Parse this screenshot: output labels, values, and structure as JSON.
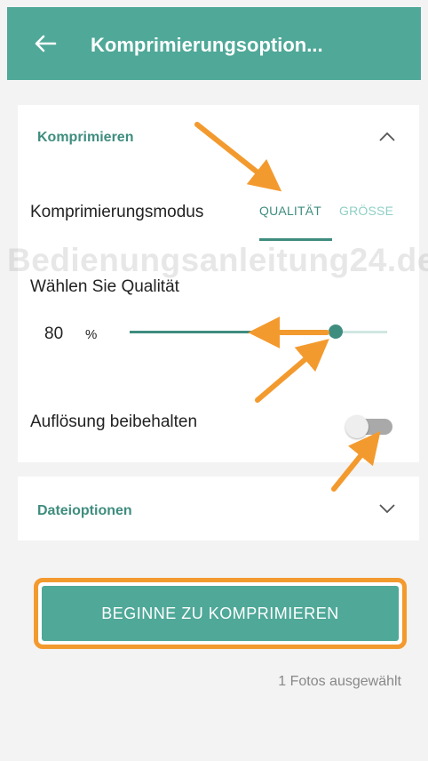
{
  "appbar": {
    "title": "Komprimierungsoption..."
  },
  "compress_section": {
    "title": "Komprimieren",
    "mode_label": "Komprimierungsmodus",
    "tabs": [
      {
        "label": "QUALITÄT",
        "selected": true
      },
      {
        "label": "GRÖSSE",
        "selected": false
      }
    ],
    "quality_label": "Wählen Sie Qualität",
    "quality_value": "80",
    "quality_unit": "%",
    "quality_slider_fraction": 0.8,
    "keep_resolution_label": "Auflösung beibehalten",
    "keep_resolution_on": false
  },
  "file_section": {
    "title": "Dateioptionen"
  },
  "cta_label": "BEGINNE ZU KOMPRIMIEREN",
  "selected_count": "1 Fotos ausgewählt",
  "watermark": "Bedienungsanleitung24.de",
  "colors": {
    "accent": "#4fa898",
    "accent_dark": "#3f8d7f",
    "annotation": "#f39a2f"
  },
  "icons": {
    "back": "arrow-left-icon",
    "collapse": "chevron-up-icon",
    "expand": "chevron-down-icon"
  }
}
